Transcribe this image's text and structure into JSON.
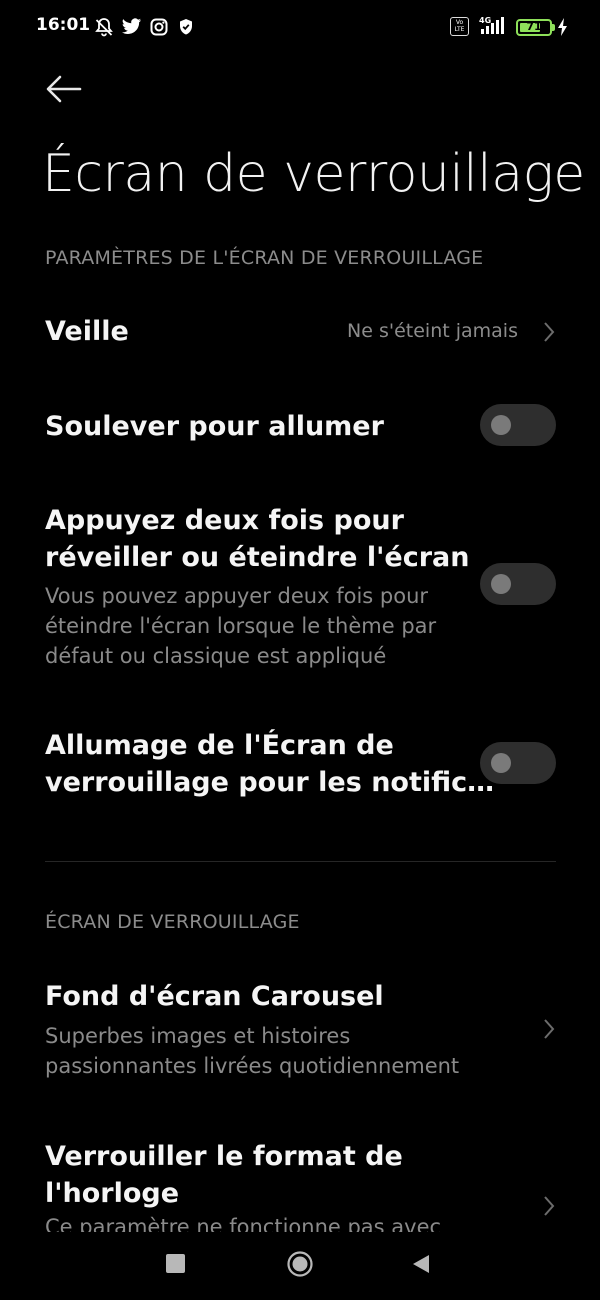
{
  "status_bar": {
    "time": "16:01",
    "icons": [
      "silent-bell-icon",
      "twitter-icon",
      "instagram-icon",
      "shield-icon"
    ],
    "volte": "Vo LTE",
    "network": "4G",
    "battery_level": "71",
    "battery_fraction": 0.71,
    "charging": true,
    "accent_color": "#8ee05a"
  },
  "header": {
    "back_icon": "arrow-left-icon",
    "title": "Écran de verrouillage"
  },
  "sections": [
    {
      "header": "PARAMÈTRES DE L'ÉCRAN DE VERROUILLAGE",
      "items": [
        {
          "title": "Veille",
          "value": "Ne s'éteint jamais",
          "control": "chevron"
        },
        {
          "title": "Soulever pour allumer",
          "control": "toggle",
          "on": false
        },
        {
          "title_line1": "Appuyez deux fois pour",
          "title_line2": "réveiller ou éteindre l'écran",
          "sub_line1": "Vous pouvez appuyer deux fois pour",
          "sub_line2": "éteindre l'écran lorsque le thème par",
          "sub_line3": "défaut ou classique est appliqué",
          "control": "toggle",
          "on": false
        },
        {
          "title_line1": "Allumage de l'Écran de",
          "title_line2": "verrouillage pour les notific…",
          "control": "toggle",
          "on": false
        }
      ]
    },
    {
      "header": "ÉCRAN DE VERROUILLAGE",
      "items": [
        {
          "title": "Fond d'écran Carousel",
          "sub_line1": "Superbes images et histoires",
          "sub_line2": "passionnantes livrées quotidiennement",
          "control": "chevron"
        },
        {
          "title_line1": "Verrouiller le format de",
          "title_line2": "l'horloge",
          "sub_partial": "Ce paramètre ne fonctionne pas avec",
          "control": "chevron"
        }
      ]
    }
  ],
  "nav_bar": {
    "buttons": [
      "recent-apps-icon",
      "home-icon",
      "back-triangle-icon"
    ]
  }
}
